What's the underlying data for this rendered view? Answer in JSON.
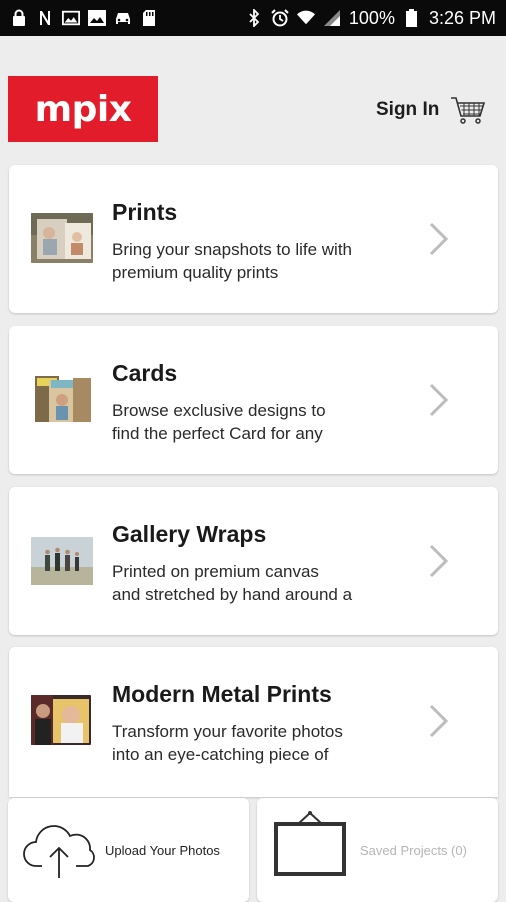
{
  "status_bar": {
    "battery": "100%",
    "time": "3:26 PM",
    "left_icons": [
      "lock-icon",
      "n-icon",
      "image-icon",
      "photo-icon",
      "car-icon",
      "sd-card-icon"
    ],
    "right_icons": [
      "bluetooth-icon",
      "alarm-icon",
      "wifi-icon",
      "signal-icon",
      "battery-icon"
    ]
  },
  "header": {
    "logo_text": "mpix",
    "logo_color": "#e21c2a",
    "sign_in_label": "Sign In",
    "cart_icon": "cart-icon"
  },
  "products": [
    {
      "title": "Prints",
      "desc_line1": "Bring your snapshots to life with",
      "desc_line2": "premium quality prints"
    },
    {
      "title": "Cards",
      "desc_line1": "Browse exclusive designs to",
      "desc_line2": "find the perfect Card for any"
    },
    {
      "title": "Gallery Wraps",
      "desc_line1": "Printed on premium canvas",
      "desc_line2": "and stretched by hand around a"
    },
    {
      "title": "Modern Metal Prints",
      "desc_line1": "Transform your favorite photos",
      "desc_line2": "into an eye-catching piece of"
    }
  ],
  "bottom": {
    "upload_label": "Upload Your Photos",
    "saved_label": "Saved Projects (0)"
  }
}
